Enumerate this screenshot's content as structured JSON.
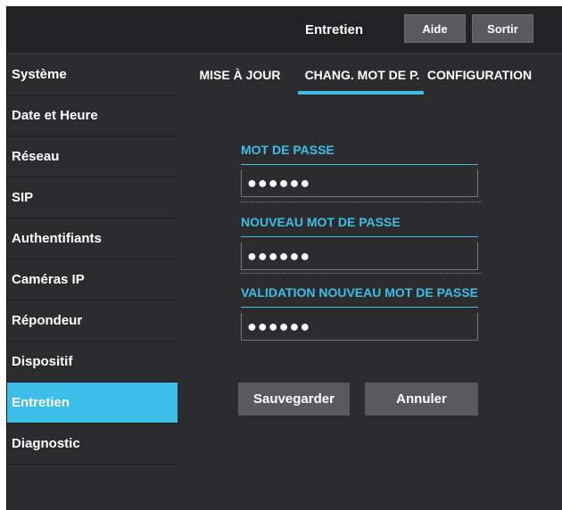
{
  "header": {
    "title": "Entretien",
    "help_label": "Aide",
    "exit_label": "Sortir"
  },
  "sidebar": {
    "items": [
      {
        "label": "Système"
      },
      {
        "label": "Date et Heure"
      },
      {
        "label": "Réseau"
      },
      {
        "label": "SIP"
      },
      {
        "label": "Authentifiants"
      },
      {
        "label": "Caméras IP"
      },
      {
        "label": "Répondeur"
      },
      {
        "label": "Dispositif"
      },
      {
        "label": "Entretien",
        "active": true
      },
      {
        "label": "Diagnostic"
      }
    ]
  },
  "tabs": [
    {
      "label": "MISE À JOUR"
    },
    {
      "label": "CHANG. MOT DE P.",
      "active": true
    },
    {
      "label": "CONFIGURATION"
    }
  ],
  "form": {
    "current_password": {
      "label": "MOT DE PASSE",
      "value": "●●●●●●"
    },
    "new_password": {
      "label": "NOUVEAU MOT DE PASSE",
      "value": "●●●●●●"
    },
    "confirm_password": {
      "label": "VALIDATION NOUVEAU MOT DE PASSE",
      "value": "●●●●●●"
    },
    "save_label": "Sauvegarder",
    "cancel_label": "Annuler"
  },
  "colors": {
    "accent": "#3bbfe9",
    "background": "#2c2c2e",
    "header": "#222224",
    "button": "#5a5a5d"
  }
}
